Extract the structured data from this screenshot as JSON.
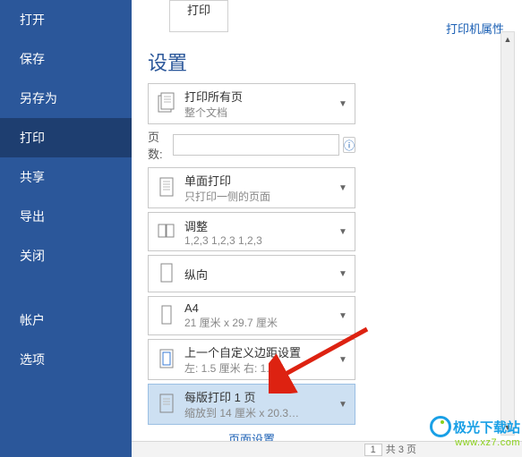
{
  "sidebar": {
    "items": [
      {
        "label": "打开"
      },
      {
        "label": "保存"
      },
      {
        "label": "另存为"
      },
      {
        "label": "打印"
      },
      {
        "label": "共享"
      },
      {
        "label": "导出"
      },
      {
        "label": "关闭"
      }
    ],
    "bottom": [
      {
        "label": "帐户"
      },
      {
        "label": "选项"
      }
    ]
  },
  "preview_label": "打印",
  "top_link": "打印机属性",
  "section_title": "设置",
  "pages": {
    "label": "页数:",
    "value": ""
  },
  "dropdowns": {
    "scope": {
      "line1": "打印所有页",
      "line2": "整个文档"
    },
    "side": {
      "line1": "单面打印",
      "line2": "只打印一侧的页面"
    },
    "collate": {
      "line1": "调整",
      "line2": "1,2,3    1,2,3    1,2,3"
    },
    "orient": {
      "line1": "纵向",
      "line2": ""
    },
    "paper": {
      "line1": "A4",
      "line2": "21 厘米 x 29.7 厘米"
    },
    "margin": {
      "line1": "上一个自定义边距设置",
      "line2": "左:  1.5 厘米   右:  1.5…"
    },
    "perpage": {
      "line1": "每版打印 1 页",
      "line2": "缩放到 14 厘米 x 20.3…"
    }
  },
  "bottom_link": "页面设置",
  "pager": {
    "page": "1",
    "total_label": "共 3 页"
  },
  "watermark": {
    "name": "极光下载站",
    "url": "www.xz7.com"
  }
}
